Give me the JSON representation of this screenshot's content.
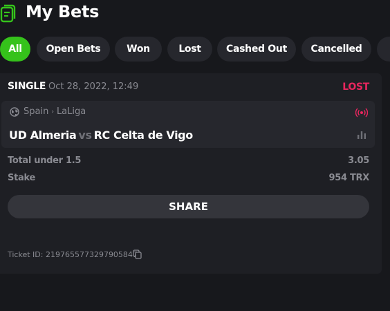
{
  "header": {
    "title": "My Bets",
    "icon": "betslip-icon",
    "accent": "#35c21b"
  },
  "tabs": [
    {
      "label": "All",
      "active": true
    },
    {
      "label": "Open Bets"
    },
    {
      "label": "Won"
    },
    {
      "label": "Lost"
    },
    {
      "label": "Cashed Out"
    },
    {
      "label": "Cancelled"
    }
  ],
  "bet": {
    "type": "SINGLE",
    "date": "Oct 28, 2022, 12:49",
    "status": "LOST",
    "status_color": "#e8265e",
    "event": {
      "country": "Spain",
      "league": "LaLiga",
      "home": "UD Almeria",
      "vs": "vs",
      "away": "RC Celta de Vigo"
    },
    "selection": {
      "label": "Total under 1.5",
      "odds": "3.05"
    },
    "stake": {
      "label": "Stake",
      "value": "954 TRX"
    },
    "share_label": "SHARE",
    "ticket": "Ticket ID: 2197655773297905847"
  }
}
